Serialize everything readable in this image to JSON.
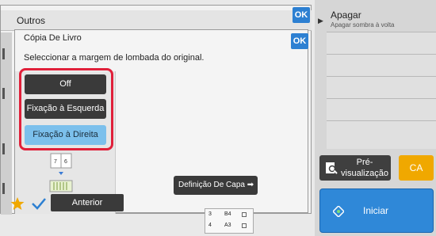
{
  "outros": {
    "title": "Outros",
    "ok_label": "OK"
  },
  "dialog": {
    "title": "Cópia De Livro",
    "ok_label": "OK",
    "message": "Seleccionar a margem de lombada do original.",
    "options": [
      {
        "label": "Off",
        "selected": false
      },
      {
        "label": "Fixação à Esquerda",
        "selected": false
      },
      {
        "label": "Fixação à Direita",
        "selected": true
      }
    ],
    "cover_button_label": "Definição De Capa",
    "book_icon_pages": "7 6"
  },
  "right_panel": {
    "apagar_title": "Apagar",
    "apagar_subtitle": "Apagar sombra à volta",
    "preview_label_line1": "Pré-",
    "preview_label_line2": "visualização",
    "ca_label": "CA",
    "start_label": "Iniciar"
  },
  "bottom_bar": {
    "previous_label": "Anterior",
    "trays": [
      {
        "number": "3",
        "size": "B4"
      },
      {
        "number": "4",
        "size": "A3"
      }
    ]
  },
  "colors": {
    "ok_blue": "#2d80d2",
    "selected_option": "#7cc0ec",
    "highlight_frame": "#e0203a",
    "ca_orange": "#f0a800",
    "start_blue": "#2f88d8"
  }
}
